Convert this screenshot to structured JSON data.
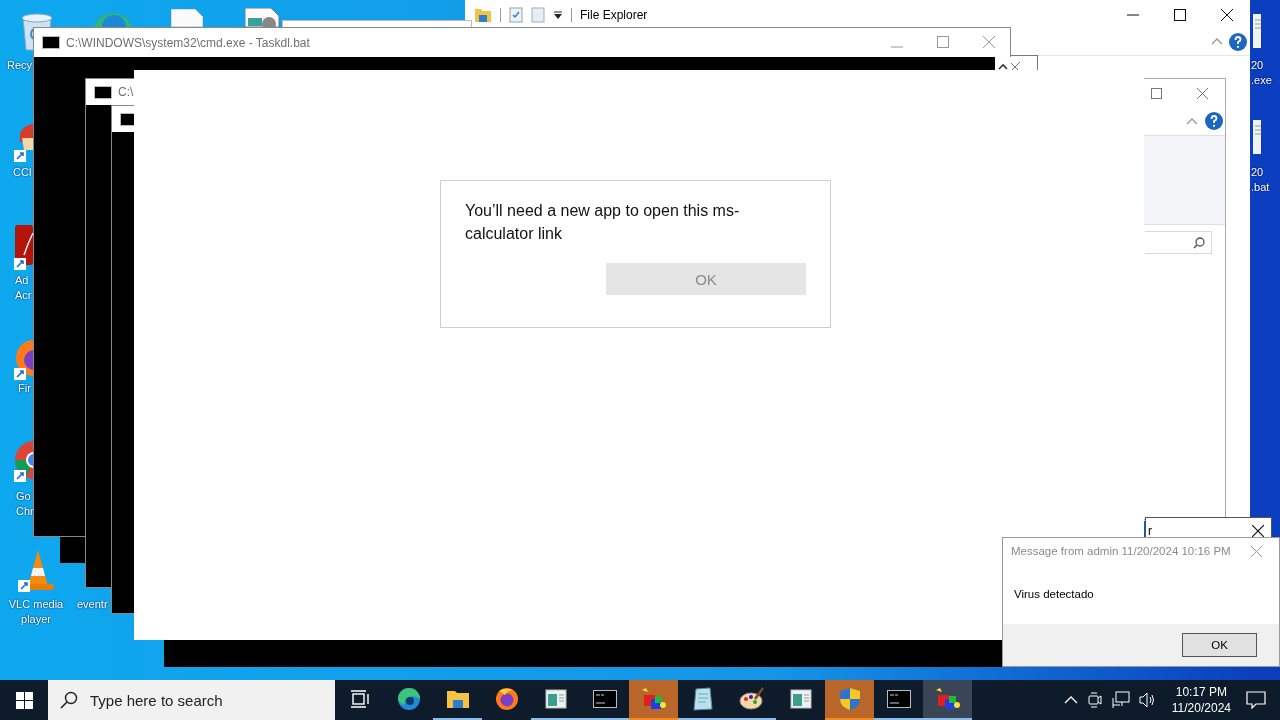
{
  "desktop_icons": [
    {
      "kind": "recycle-bin",
      "lines": [
        "Recy"
      ]
    },
    {
      "kind": "cleaner",
      "lines": [
        "CCl"
      ]
    },
    {
      "kind": "pdf-reader",
      "lines": [
        "Ad",
        "Acr"
      ]
    },
    {
      "kind": "firefox",
      "lines": [
        "Fir"
      ]
    },
    {
      "kind": "chrome",
      "lines": [
        "Go",
        "Chr"
      ]
    },
    {
      "kind": "vlc",
      "lines": [
        "VLC media",
        "player"
      ]
    },
    {
      "kind": "label-only",
      "lines": [
        "eventr"
      ]
    },
    {
      "kind": "file",
      "lines": [
        "20",
        ".exe"
      ]
    },
    {
      "kind": "file",
      "lines": [
        "20",
        ".bat"
      ]
    }
  ],
  "file_explorer": {
    "title": "File Explorer"
  },
  "console": {
    "title": "C:\\WINDOWS\\system32\\cmd.exe - Taskdl.bat"
  },
  "console_2": {
    "title": "C:\\"
  },
  "app_dialog": {
    "message": "You’ll need a new app to open this ms-calculator link",
    "button": "OK"
  },
  "background_window": {
    "text": "r"
  },
  "message_box": {
    "title": "Message from admin 11/20/2024 10:16 PM",
    "body": "Virus detectado",
    "button": "OK"
  },
  "taskbar": {
    "search_placeholder": "Type here to search",
    "apps": [
      {
        "kind": "task-view",
        "running": false,
        "flashing": false,
        "selected": false
      },
      {
        "kind": "edge",
        "running": false,
        "flashing": false,
        "selected": false
      },
      {
        "kind": "folder",
        "running": true,
        "flashing": false,
        "selected": false
      },
      {
        "kind": "firefox",
        "running": false,
        "flashing": false,
        "selected": false
      },
      {
        "kind": "app-window",
        "running": true,
        "flashing": false,
        "selected": false
      },
      {
        "kind": "console",
        "running": true,
        "flashing": false,
        "selected": false
      },
      {
        "kind": "cubes",
        "running": true,
        "flashing": true,
        "selected": false
      },
      {
        "kind": "notepad",
        "running": true,
        "flashing": false,
        "selected": false
      },
      {
        "kind": "paint",
        "running": true,
        "flashing": false,
        "selected": false
      },
      {
        "kind": "app-window",
        "running": false,
        "flashing": false,
        "selected": false
      },
      {
        "kind": "shield",
        "running": true,
        "flashing": true,
        "selected": false
      },
      {
        "kind": "console",
        "running": true,
        "flashing": false,
        "selected": false
      },
      {
        "kind": "cubes",
        "running": true,
        "flashing": false,
        "selected": true
      }
    ],
    "time": "10:17 PM",
    "date": "11/20/2024"
  }
}
